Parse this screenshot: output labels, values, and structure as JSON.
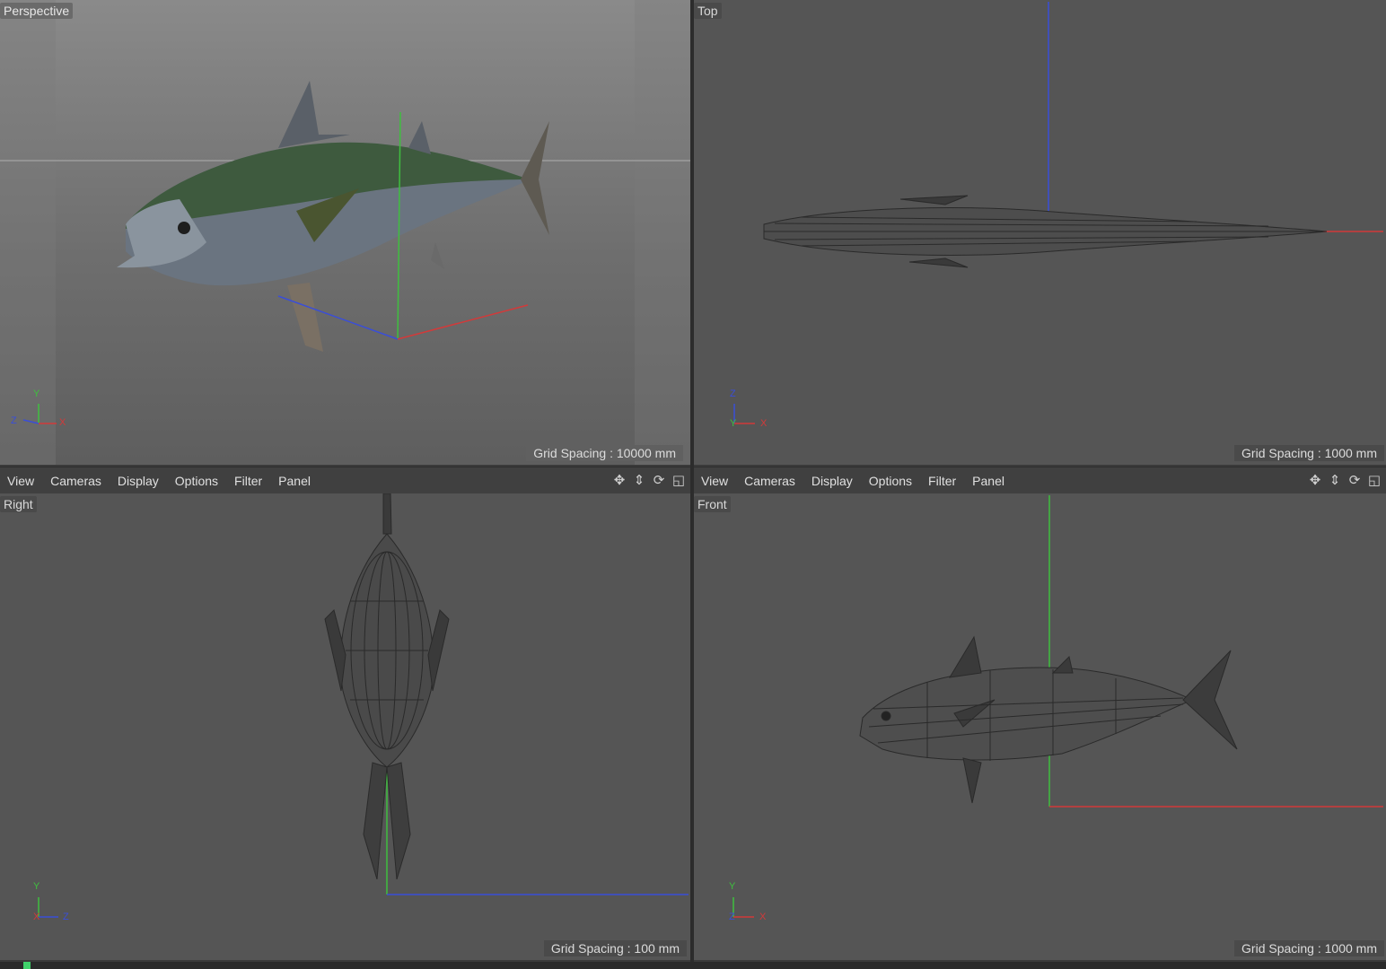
{
  "viewports": {
    "perspective": {
      "label": "Perspective",
      "grid": "Grid Spacing : 10000 mm",
      "axes": [
        "Y",
        "Z",
        "X"
      ]
    },
    "top": {
      "label": "Top",
      "grid": "Grid Spacing : 1000 mm",
      "axes": [
        "Z",
        "Y",
        "X"
      ]
    },
    "right": {
      "label": "Right",
      "grid": "Grid Spacing : 100 mm",
      "axes": [
        "Y",
        "X",
        "Z"
      ]
    },
    "front": {
      "label": "Front",
      "grid": "Grid Spacing : 1000 mm",
      "axes": [
        "Y",
        "Z",
        "X"
      ]
    }
  },
  "menu": [
    "View",
    "Cameras",
    "Display",
    "Options",
    "Filter",
    "Panel"
  ],
  "nav_icons": [
    "move-view-icon",
    "zoom-view-icon",
    "rotate-view-icon",
    "toggle-layout-icon"
  ],
  "nav_glyphs": [
    "✥",
    "⇕",
    "⟳",
    "◱"
  ],
  "colors": {
    "axis_x": "#d23a3a",
    "axis_y": "#3fbf3f",
    "axis_z": "#3a4ed8",
    "wire": "#2a2a2a"
  }
}
